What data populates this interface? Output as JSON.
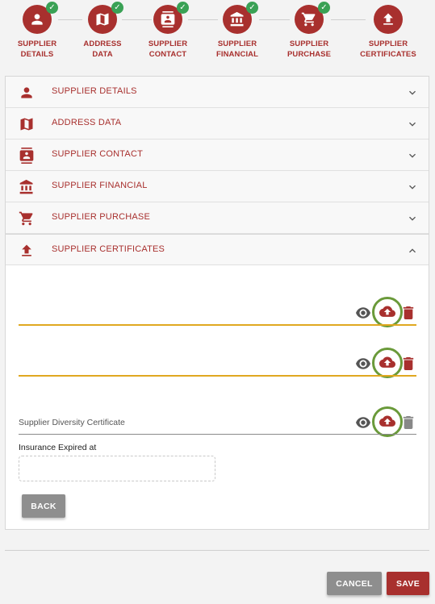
{
  "stepper": {
    "steps": [
      {
        "label": "SUPPLIER\nDETAILS",
        "icon": "person-icon",
        "completed": true
      },
      {
        "label": "ADDRESS\nDATA",
        "icon": "map-icon",
        "completed": true
      },
      {
        "label": "SUPPLIER\nCONTACT",
        "icon": "contact-card-icon",
        "completed": true
      },
      {
        "label": "SUPPLIER\nFINANCIAL",
        "icon": "bank-icon",
        "completed": true
      },
      {
        "label": "SUPPLIER\nPURCHASE",
        "icon": "cart-icon",
        "completed": true
      },
      {
        "label": "SUPPLIER\nCERTIFICATES",
        "icon": "upload-icon",
        "completed": false
      }
    ],
    "check_glyph": "✓"
  },
  "accordion": {
    "items": [
      {
        "title": "SUPPLIER DETAILS",
        "icon": "person-icon",
        "expanded": false
      },
      {
        "title": "ADDRESS DATA",
        "icon": "map-icon",
        "expanded": false
      },
      {
        "title": "SUPPLIER CONTACT",
        "icon": "contact-card-icon",
        "expanded": false
      },
      {
        "title": "SUPPLIER FINANCIAL",
        "icon": "bank-icon",
        "expanded": false
      },
      {
        "title": "SUPPLIER PURCHASE",
        "icon": "cart-icon",
        "expanded": false
      },
      {
        "title": "SUPPLIER CERTIFICATES",
        "icon": "upload-icon",
        "expanded": true
      }
    ]
  },
  "certificates": {
    "fields": [
      {
        "label": "",
        "status": "highlighted"
      },
      {
        "label": "",
        "status": "highlighted"
      },
      {
        "label": "Supplier Diversity Certificate",
        "status": "normal"
      }
    ],
    "insurance_label": "Insurance Expired at",
    "insurance_value": "",
    "back_label": "BACK"
  },
  "footer": {
    "cancel_label": "CANCEL",
    "save_label": "SAVE"
  },
  "colors": {
    "brand": "#a8302e",
    "success": "#3aa155",
    "highlight_line": "#e0a820",
    "ring": "#6a9a3a"
  }
}
